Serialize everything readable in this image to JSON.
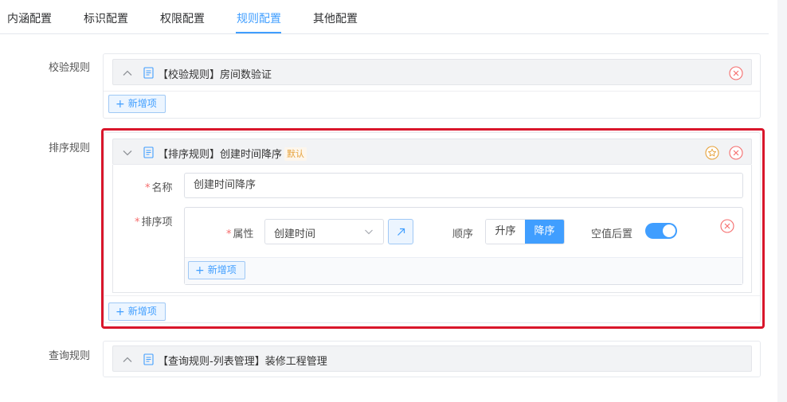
{
  "tabs": [
    {
      "label": "内涵配置",
      "active": false
    },
    {
      "label": "标识配置",
      "active": false
    },
    {
      "label": "权限配置",
      "active": false
    },
    {
      "label": "规则配置",
      "active": true
    },
    {
      "label": "其他配置",
      "active": false
    }
  ],
  "sections": {
    "validation": {
      "label": "校验规则",
      "rule_title": "【校验规则】房间数验证",
      "add_label": "新增项"
    },
    "sort": {
      "label": "排序规则",
      "rule_title": "【排序规则】创建时间降序",
      "default_tag": "默认",
      "name_label": "名称",
      "name_value": "创建时间降序",
      "items_label": "排序项",
      "property_label": "属性",
      "property_value": "创建时间",
      "order_label": "顺序",
      "order_options": [
        "升序",
        "降序"
      ],
      "order_selected": "降序",
      "null_last_label": "空值后置",
      "null_last_on": true,
      "inner_add_label": "新增项",
      "add_label": "新增项"
    },
    "query": {
      "label": "查询规则",
      "rule_title": "【查询规则-列表管理】装修工程管理"
    }
  },
  "colors": {
    "accent": "#409eff",
    "danger": "#f56c6c",
    "warning": "#e6a23c",
    "highlight": "#d9162b"
  },
  "icons": {
    "collapse": "chevron-up-icon",
    "expand": "chevron-down-icon",
    "rule": "document-icon",
    "remove": "close-circle-icon",
    "set_default": "star-icon",
    "link": "arrow-up-right-icon",
    "add": "plus-icon"
  }
}
